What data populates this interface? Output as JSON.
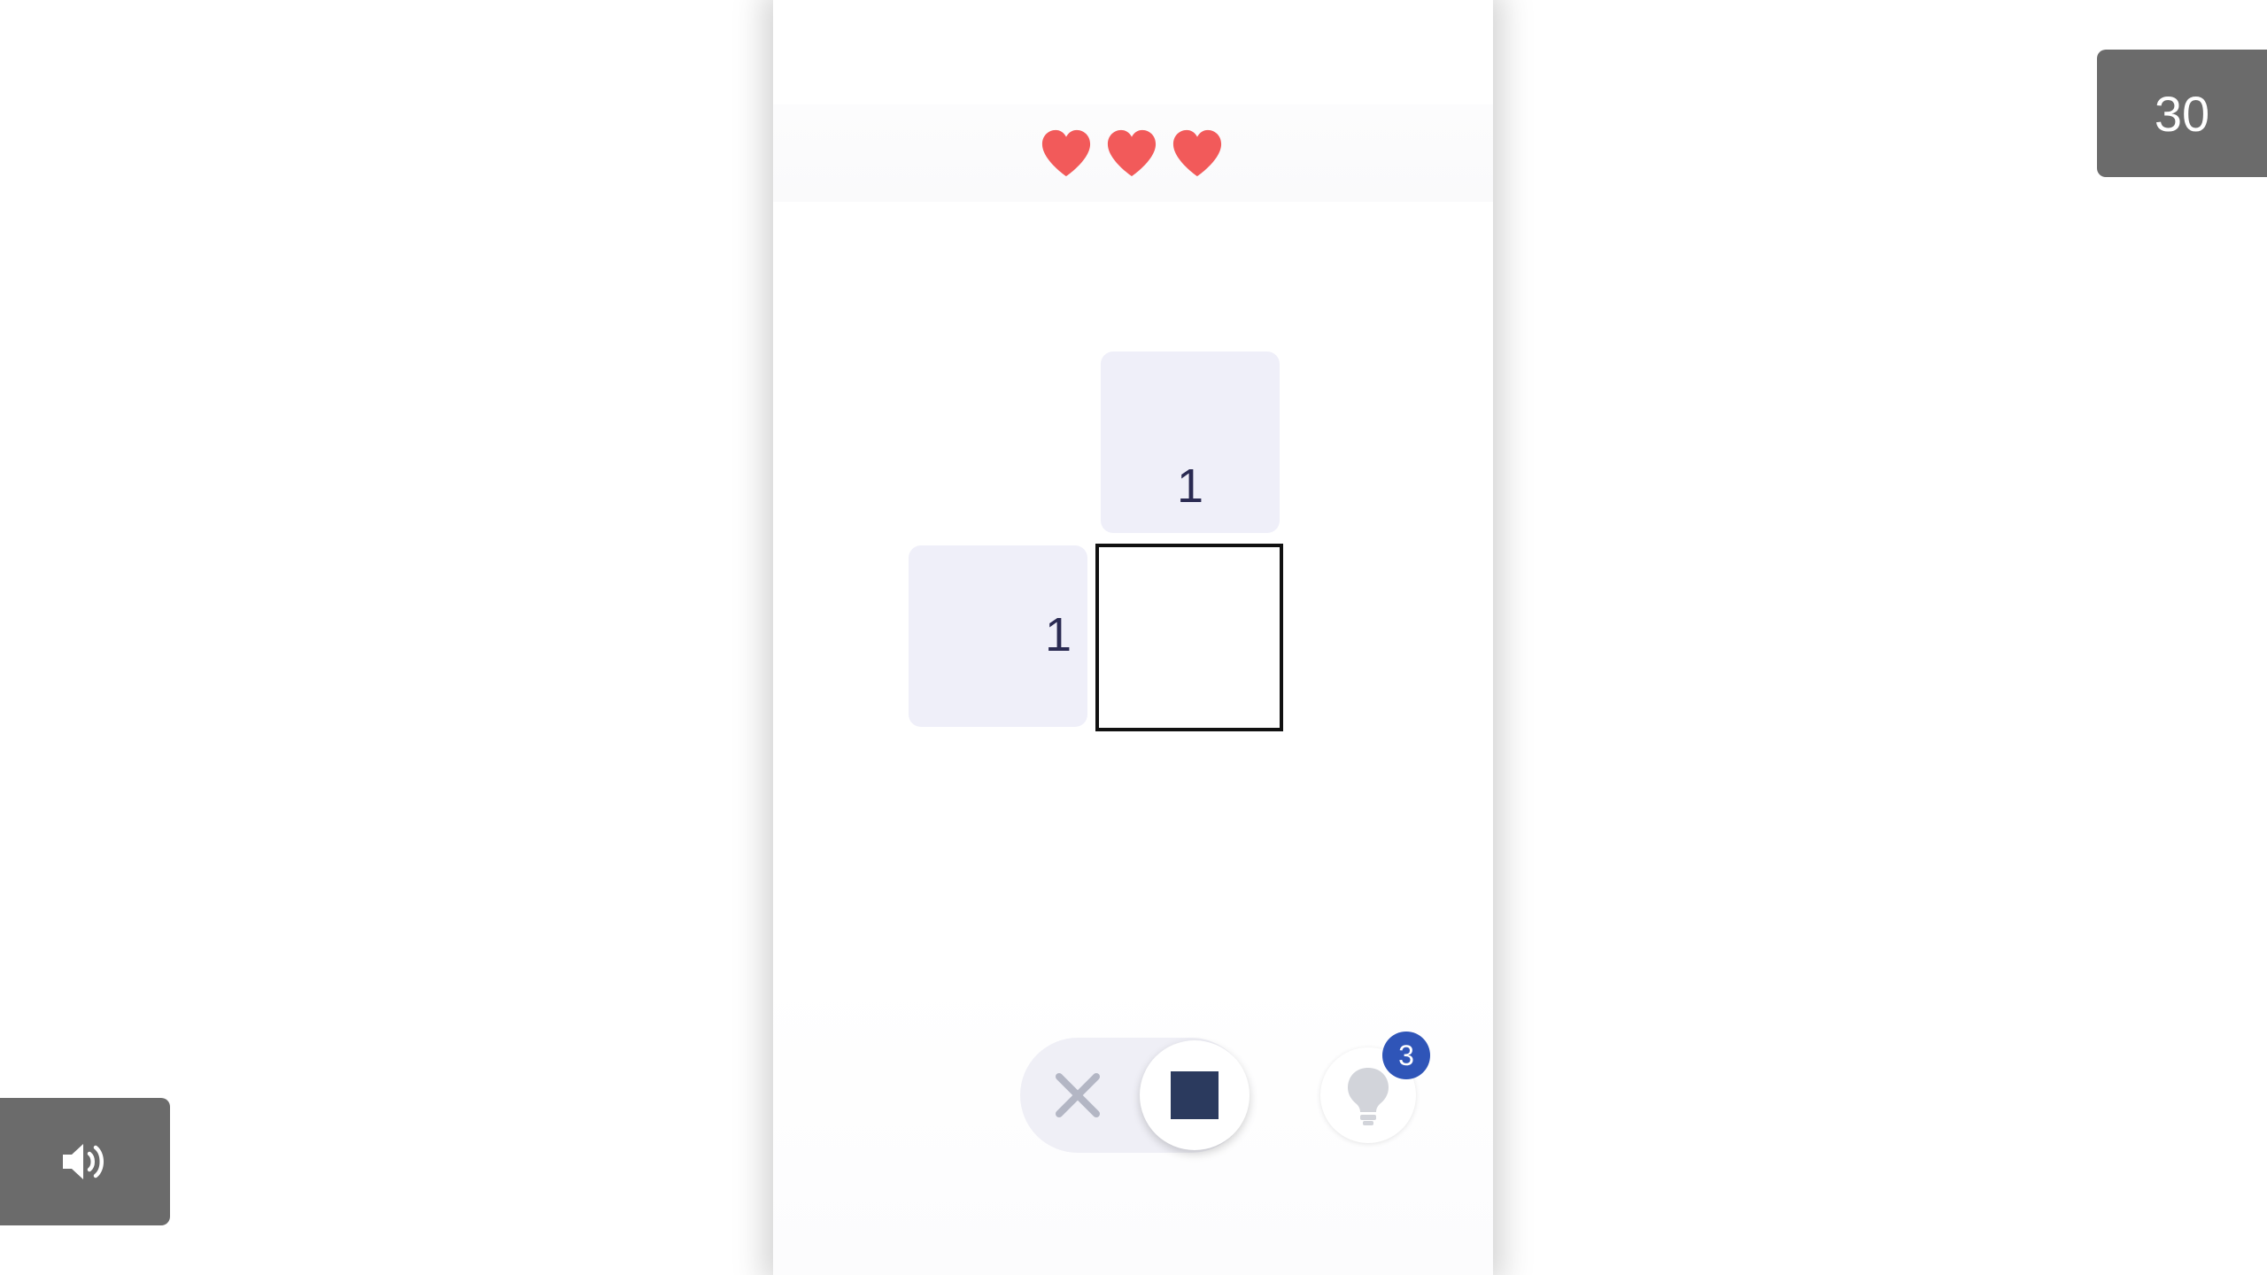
{
  "game": {
    "lives": 3,
    "heart_color": "#f25a5a",
    "clues": {
      "column_top": "1",
      "row_left": "1"
    },
    "grid": {
      "rows": 1,
      "cols": 1,
      "cells": [
        "empty"
      ]
    }
  },
  "controls": {
    "mode_toggle": {
      "options": [
        "cross",
        "fill"
      ],
      "selected": "fill",
      "cross_icon": "x-icon",
      "fill_icon": "filled-square-icon"
    },
    "hint": {
      "icon": "lightbulb-icon",
      "count": "3",
      "badge_color": "#2f55b8"
    }
  },
  "overlay": {
    "timer": "30",
    "sound_icon": "speaker-icon"
  }
}
